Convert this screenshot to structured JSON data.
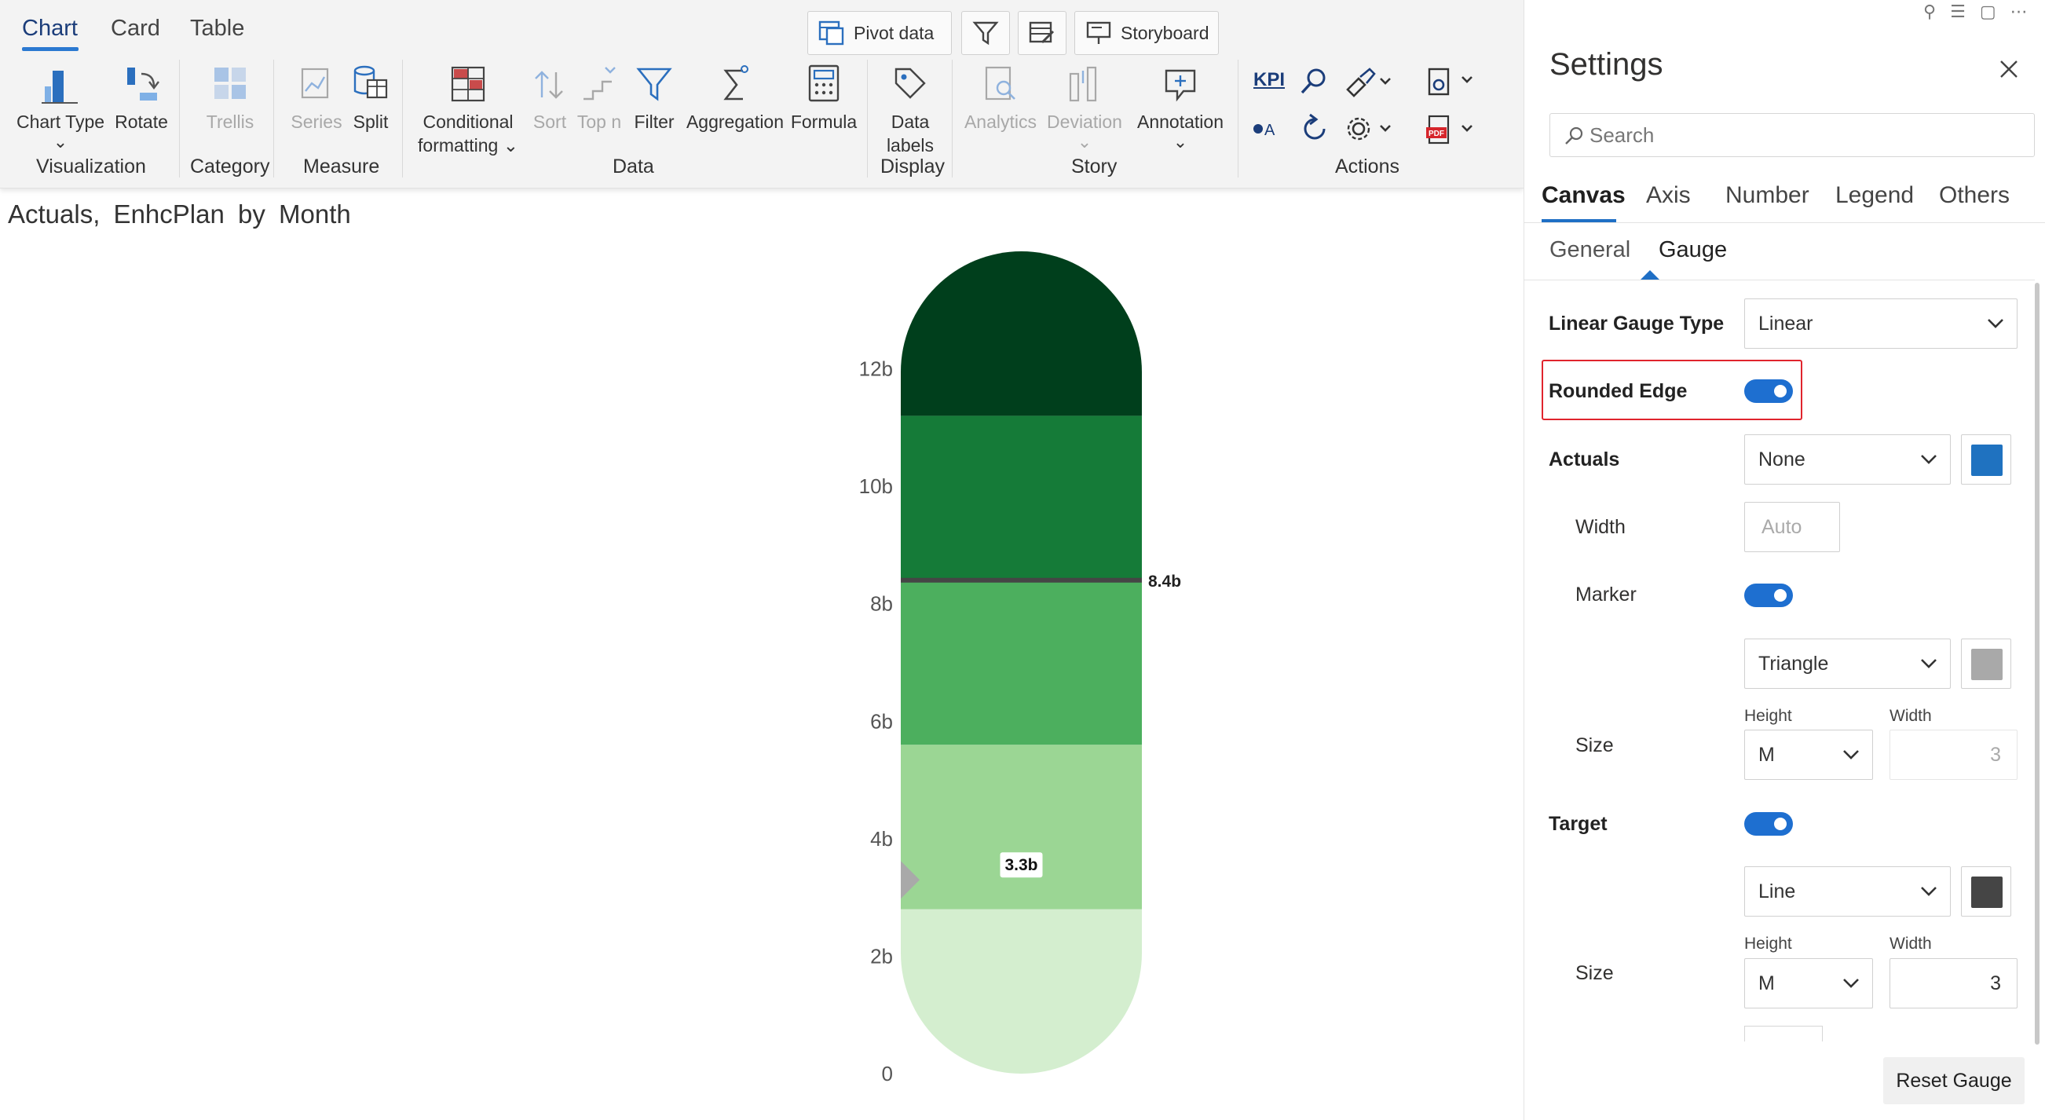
{
  "ribbon": {
    "tabs": [
      "Chart",
      "Card",
      "Table"
    ],
    "top_buttons": {
      "pivot": "Pivot data",
      "storyboard": "Storyboard"
    },
    "items": {
      "chart_type": "Chart Type",
      "rotate": "Rotate",
      "trellis": "Trellis",
      "series": "Series",
      "split": "Split",
      "conditional_1": "Conditional",
      "conditional_2": "formatting",
      "sort": "Sort",
      "topn": "Top n",
      "filter": "Filter",
      "aggregation": "Aggregation",
      "formula": "Formula",
      "data_labels_1": "Data",
      "data_labels_2": "labels",
      "analytics": "Analytics",
      "deviation": "Deviation",
      "annotation": "Annotation",
      "kpi": "KPI"
    },
    "groups": {
      "visualization": "Visualization",
      "category": "Category",
      "measure": "Measure",
      "data": "Data",
      "display": "Display",
      "story": "Story",
      "actions": "Actions"
    }
  },
  "chart_title": "Actuals, EnhcPlan by Month",
  "chart_data": {
    "type": "linear-gauge",
    "title": "Actuals, EnhcPlan by Month",
    "ylim": [
      0,
      14
    ],
    "tick_labels": [
      "0",
      "2b",
      "4b",
      "6b",
      "8b",
      "10b",
      "12b"
    ],
    "tick_values": [
      0,
      2,
      4,
      6,
      8,
      10,
      12
    ],
    "bands": [
      {
        "from": 0,
        "to": 2.8,
        "color": "#d4eecf"
      },
      {
        "from": 2.8,
        "to": 5.6,
        "color": "#9bd694"
      },
      {
        "from": 5.6,
        "to": 8.4,
        "color": "#4caf5e"
      },
      {
        "from": 8.4,
        "to": 11.2,
        "color": "#157b38"
      },
      {
        "from": 11.2,
        "to": 14,
        "color": "#003f1c"
      }
    ],
    "actual": {
      "value": 3.3,
      "label": "3.3b",
      "marker": "Triangle"
    },
    "target": {
      "value": 8.4,
      "label": "8.4b",
      "marker": "Line"
    },
    "rounded_edge": true
  },
  "settings": {
    "title": "Settings",
    "search_placeholder": "Search",
    "tabs": [
      "Canvas",
      "Axis",
      "Number",
      "Legend",
      "Others"
    ],
    "subtabs": [
      "General",
      "Gauge"
    ],
    "linear_gauge_type_label": "Linear Gauge Type",
    "linear_gauge_type_value": "Linear",
    "rounded_edge_label": "Rounded Edge",
    "actuals_label": "Actuals",
    "actuals_value": "None",
    "actuals_color": "#1f72c0",
    "width_label": "Width",
    "width_placeholder": "Auto",
    "marker_label": "Marker",
    "marker_shape": "Triangle",
    "marker_color": "#a9a9a9",
    "size_label": "Size",
    "height_label": "Height",
    "width_col_label": "Width",
    "marker_height": "M",
    "marker_width": "3",
    "target_label": "Target",
    "target_shape": "Line",
    "target_color": "#454545",
    "target_height": "M",
    "target_width": "3",
    "reset_button": "Reset Gauge"
  }
}
